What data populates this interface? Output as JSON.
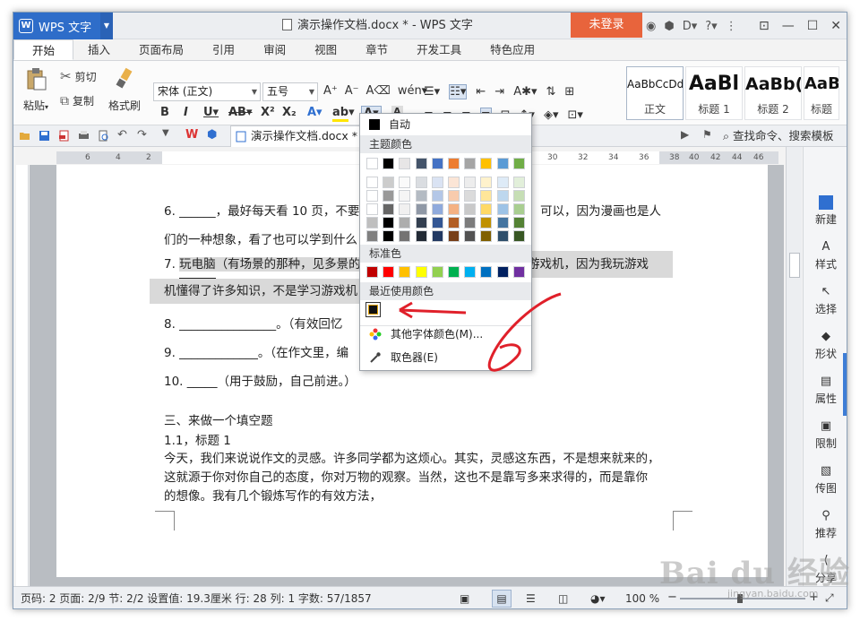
{
  "titlebar": {
    "app_name": "WPS 文字",
    "doc_title": "演示操作文档.docx * - WPS 文字",
    "login": "未登录"
  },
  "tabs": [
    "开始",
    "插入",
    "页面布局",
    "引用",
    "审阅",
    "视图",
    "章节",
    "开发工具",
    "特色应用"
  ],
  "ribbon": {
    "paste": "粘贴",
    "cut": "剪切",
    "copy": "复制",
    "format_painter": "格式刷",
    "font_name": "宋体 (正文)",
    "font_size": "五号",
    "styles": [
      {
        "sample": "AaBbCcDd",
        "name": "正文"
      },
      {
        "sample": "AaBl",
        "name": "标题 1"
      },
      {
        "sample": "AaBb(",
        "name": "标题 2"
      },
      {
        "sample": "AaB",
        "name": "标题"
      }
    ]
  },
  "quickbar": {
    "doc_tab": "演示操作文档.docx *",
    "find_command": "查找命令、搜索模板"
  },
  "ruler": {
    "left_nums": [
      "6",
      "4",
      "2"
    ],
    "right_nums": [
      "30",
      "32",
      "34",
      "36",
      "38",
      "40",
      "42",
      "44",
      "46"
    ]
  },
  "document": {
    "lines": {
      "l1": "6.  ______，最好每天看 10 页，不要",
      "l1b": "可以，因为漫画也是人",
      "l2": "们的一种想象，看了也可以学到什么",
      "l3_a": "7.  ",
      "l3_b": "玩电脑",
      "l3_c": "（有场景的那种，见多景的",
      "l3_d": "游戏机，因为我玩游戏",
      "l4": "机懂得了许多知识，不是学习游戏机",
      "l5": "8.  ________________。（有效回忆",
      "l6": "9.  _____________。（在作文里，编",
      "l7": "10. _____（用于鼓励，自己前进。）",
      "l8": "三、来做一个填空题",
      "l9": "1.1，标题 1",
      "p1": "今天，我们来说说作文的灵感。许多同学都为这烦心。其实，灵感这东西，不是想来就来的，",
      "p2": "这就源于你对你自己的态度，你对万物的观察。当然，这也不是靠写多来求得的，而是靠你",
      "p3": "的想像。我有几个锻炼写作的有效方法，"
    }
  },
  "color_menu": {
    "auto": "自动",
    "theme_header": "主题颜色",
    "standard_header": "标准色",
    "recent_header": "最近使用颜色",
    "more_colors": "其他字体颜色(M)...",
    "eyedropper": "取色器(E)",
    "theme_top": [
      "#ffffff",
      "#000000",
      "#e7e6e6",
      "#44546a",
      "#4472c4",
      "#ed7d31",
      "#a5a5a5",
      "#ffc000",
      "#5b9bd5",
      "#70ad47"
    ],
    "standard": [
      "#c00000",
      "#ff0000",
      "#ffc000",
      "#ffff00",
      "#92d050",
      "#00b050",
      "#00b0f0",
      "#0070c0",
      "#002060",
      "#7030a0"
    ],
    "recent": [
      "#000000"
    ]
  },
  "sidepanel": [
    "新建",
    "样式",
    "选择",
    "形状",
    "属性",
    "限制",
    "传图",
    "推荐",
    "分享"
  ],
  "status": {
    "text": "页码: 2  页面: 2/9  节: 2/2  设置值: 19.3厘米  行: 28  列: 1  字数: 57/1857",
    "zoom": "100 %"
  },
  "watermark": {
    "main": "Bai du 经验",
    "sub": "jingyan.baidu.com"
  }
}
